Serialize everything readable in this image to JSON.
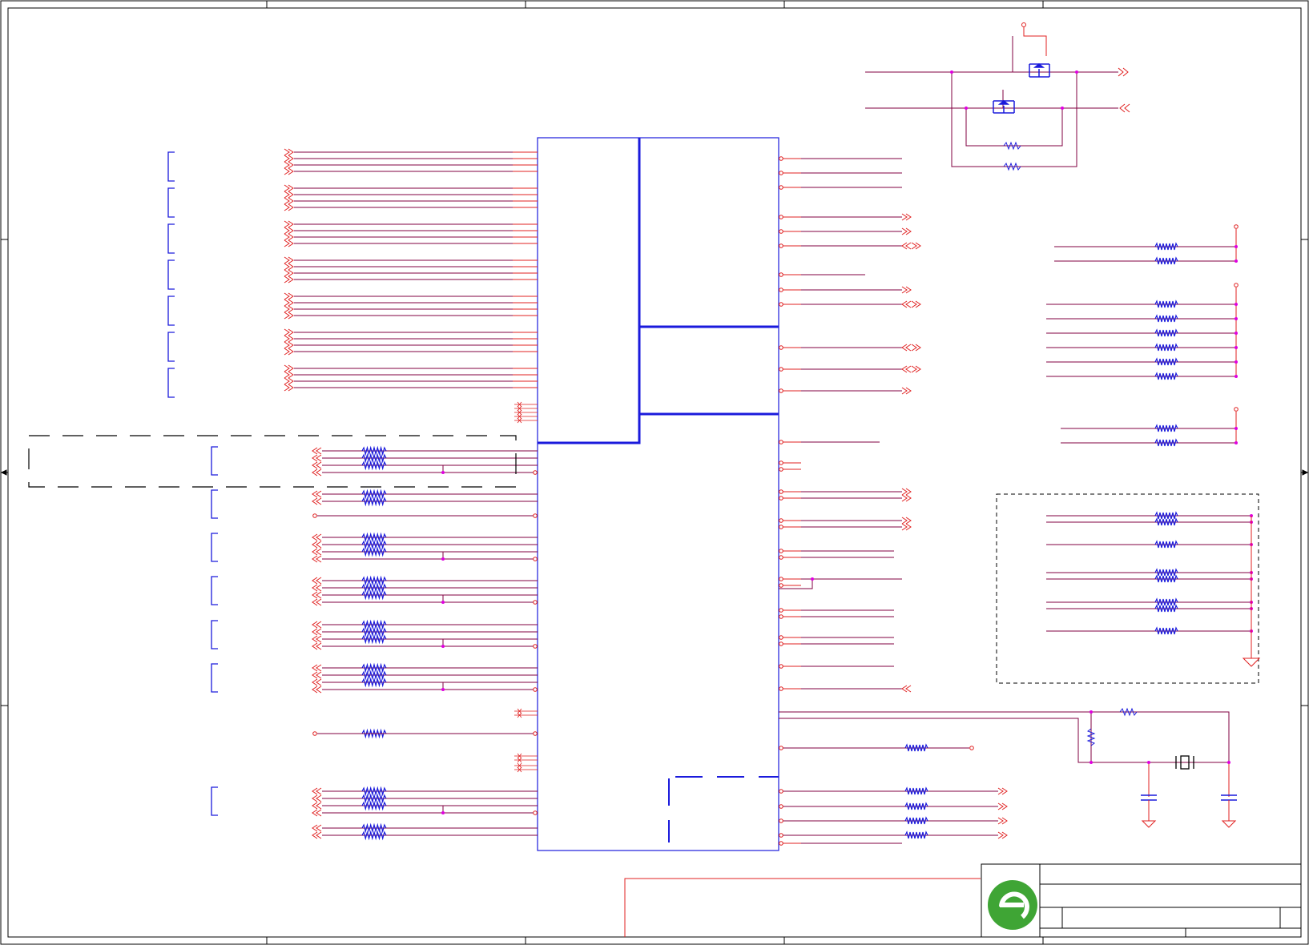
{
  "sheet": {
    "kind": "schematic",
    "zone_columns": 5,
    "zone_rows": 4
  },
  "colors": {
    "wire": "#e02020",
    "net": "#800040",
    "component": "#1a1adc",
    "junction": "#e000e0",
    "frame": "#000000",
    "logo_green": "#3fa535"
  },
  "title_block": {
    "logo": "company-logo-icon"
  }
}
